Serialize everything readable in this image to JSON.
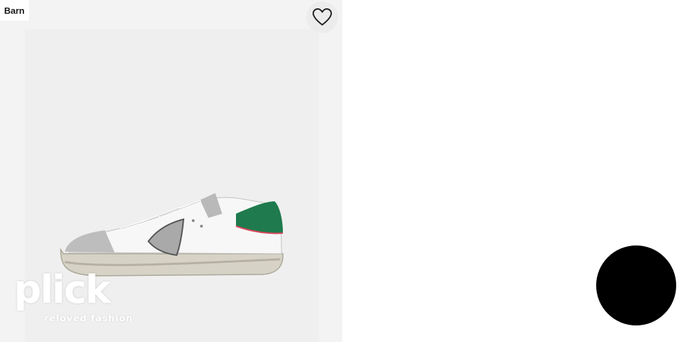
{
  "product_card": {
    "badge_label": "Barn",
    "favorite_icon": "heart-outline-icon",
    "image_alt": "White sneaker with grey suede toe, shield patch and green heel tab",
    "brand_overlay": {
      "wordmark": "plick",
      "tagline": "reloved fashion"
    }
  },
  "floating_button": {
    "color": "#000000"
  },
  "colors": {
    "card_background": "#f3f3f3",
    "shoe_accent": "#1f7a4d",
    "heel_stripe": "#d9455c"
  }
}
